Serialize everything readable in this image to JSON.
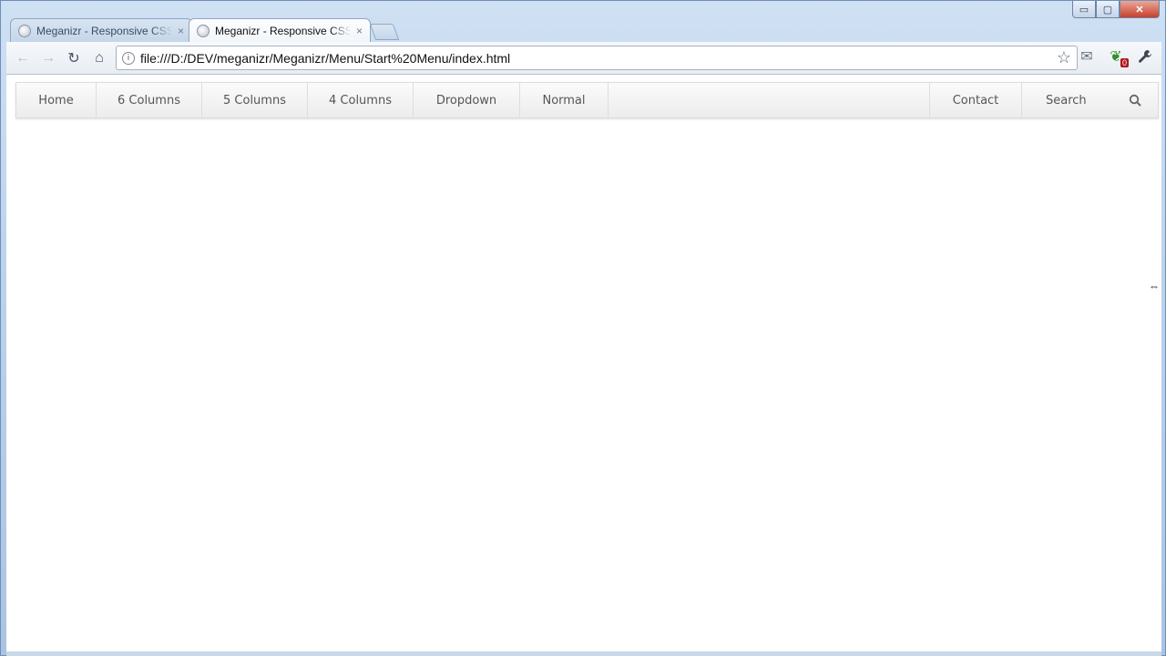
{
  "window": {
    "controls": {
      "minimize": "▭",
      "maximize": "▢",
      "close": "✕"
    }
  },
  "tabs": [
    {
      "title": "Meganizr - Responsive CSS3",
      "active": false,
      "close": "×"
    },
    {
      "title": "Meganizr - Responsive CSS3",
      "active": true,
      "close": "×"
    }
  ],
  "toolbar": {
    "back_icon": "←",
    "forward_icon": "→",
    "reload_icon": "↻",
    "home_icon": "⌂",
    "url": "file:///D:/DEV/meganizr/Meganizr/Menu/Start%20Menu/index.html",
    "star_icon": "☆",
    "extensions": [
      {
        "name": "mail-icon",
        "glyph": "✉"
      },
      {
        "name": "evernote-icon",
        "glyph": "❦",
        "badge": "0"
      },
      {
        "name": "wrench-icon",
        "glyph": "🔧"
      }
    ]
  },
  "menu": {
    "left_items": [
      "Home",
      "6 Columns",
      "5 Columns",
      "4 Columns",
      "Dropdown",
      "Normal"
    ],
    "right_items": [
      "Contact"
    ],
    "search_placeholder": "Search"
  }
}
